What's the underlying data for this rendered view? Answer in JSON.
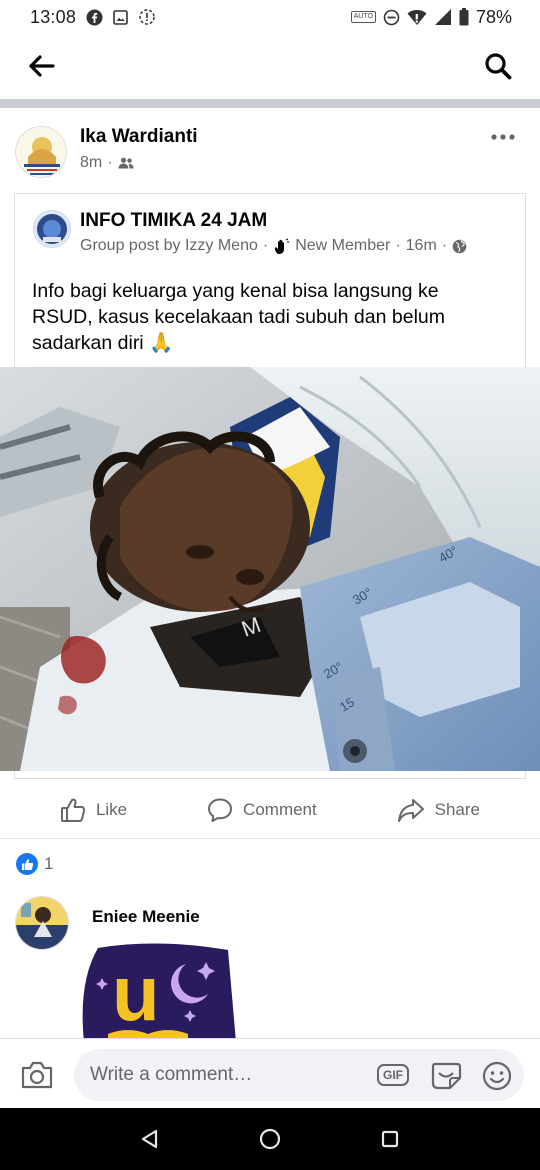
{
  "status_bar": {
    "time": "13:08",
    "battery": "78%",
    "auto_label": "AUTO"
  },
  "post": {
    "author": "Ika Wardianti",
    "time": "8m",
    "audience_icon": "friends-icon",
    "shared": {
      "group_name": "INFO TIMIKA 24 JAM",
      "byline": "Group post by Izzy Meno",
      "badge": "New Member",
      "time": "16m",
      "audience_icon": "globe-icon",
      "text": "Info bagi keluarga yang kenal bisa langsung ke RSUD, kasus kecelakaan tadi subuh dan belum sadarkan diri",
      "emoji": "🙏"
    },
    "image_text": {
      "wristband_letter": "M",
      "scale_marks": [
        "40°",
        "30°",
        "20°",
        "15"
      ]
    }
  },
  "actions": {
    "like": "Like",
    "comment": "Comment",
    "share": "Share"
  },
  "reactions": {
    "count": "1"
  },
  "comment": {
    "author": "Eniee Meenie",
    "sticker_text": "u"
  },
  "composer": {
    "placeholder": "Write a comment…",
    "gif_label": "GIF"
  },
  "colors": {
    "brand_blue": "#1877f2",
    "meta_gray": "#65676b",
    "divider": "#c9ccd1",
    "sticker_purple": "#2a1a5e",
    "sticker_yellow": "#f3c323"
  }
}
